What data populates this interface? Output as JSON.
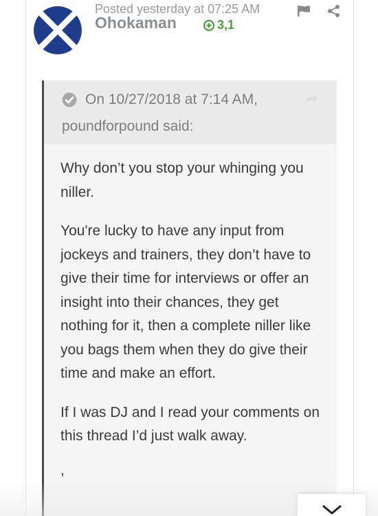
{
  "post": {
    "posted_meta": "Posted yesterday at 07:25 AM",
    "author": "Ohokaman",
    "reputation": "3,1",
    "avatar_icon": "saltire-flag-avatar",
    "actions": [
      "report-flag-icon",
      "share-icon"
    ]
  },
  "quote": {
    "date_line": "On 10/27/2018 at 7:14 AM,",
    "author": "poundforpound",
    "said": " said:",
    "paragraphs": [
      "Why don’t you stop your whinging you niller.",
      "You're lucky to have any input from jockeys and trainers, they don’t have to give their time for interviews or offer an insight into their chances, they get nothing for it, then a complete niller like you bags them when they do give their time and make an effort.",
      "If I was DJ and I read your comments on this thread I’d just walk away."
    ],
    "trailing": ","
  },
  "colors": {
    "avatar_blue": "#1f3d8a",
    "reputation_green": "#519c3a",
    "quote_border": "#4b4b4b",
    "quote_bg": "#f5f5f5",
    "quote_header_bg": "#ebebeb"
  }
}
